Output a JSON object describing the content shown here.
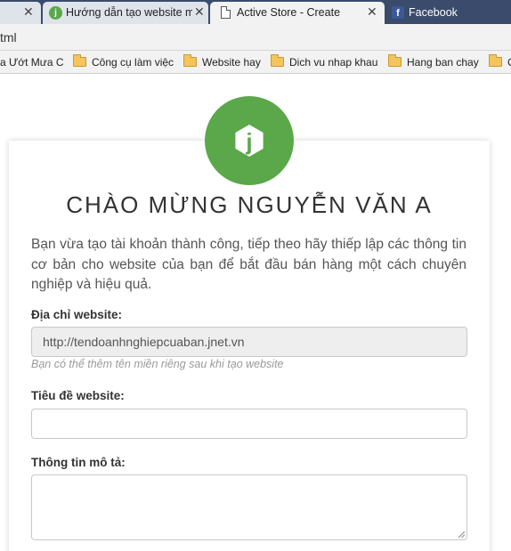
{
  "browser": {
    "tabs": [
      {
        "title": ""
      },
      {
        "title": "Hướng dẫn tạo website m",
        "icon": "jnet-favicon"
      },
      {
        "title": "Active Store - Create",
        "icon": "document-icon"
      },
      {
        "title": "Facebook",
        "icon": "facebook-icon"
      }
    ],
    "close_glyph": "✕",
    "address": "tml",
    "bookmarks": [
      {
        "label": "a Ướt Mưa C"
      },
      {
        "label": "Công cụ làm việc"
      },
      {
        "label": "Website hay"
      },
      {
        "label": "Dich vu nhap khau"
      },
      {
        "label": "Hang ban chay"
      },
      {
        "label": "C"
      }
    ]
  },
  "colors": {
    "brand_green": "#5aa84a",
    "tab_strip": "#3a4b6b"
  },
  "page": {
    "logo_letter": "j",
    "headline": "CHÀO MỪNG NGUYỄN VĂN A",
    "intro": "Bạn vừa tạo tài khoản thành công, tiếp theo hãy thiếp lập các thông tin cơ bản cho website của bạn để bắt đầu bán hàng một cách chuyên nghiệp và hiệu quả.",
    "form": {
      "website_address": {
        "label": "Địa chỉ website:",
        "value": "http://tendoanhnghiepcuaban.jnet.vn",
        "hint": "Bạn có thể thêm tên miền riêng sau khi tạo website"
      },
      "website_title": {
        "label": "Tiêu đề website:",
        "value": ""
      },
      "description": {
        "label": "Thông tin mô tả:",
        "value": ""
      }
    }
  }
}
